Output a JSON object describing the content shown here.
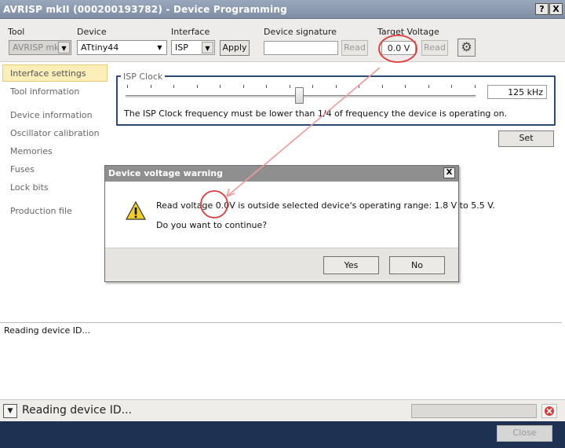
{
  "window": {
    "title": "AVRISP mkII (000200193782) - Device Programming",
    "help_label": "?",
    "close_label": "X"
  },
  "toolbar": {
    "tool_label": "Tool",
    "tool_value": "AVRISP mkII",
    "device_label": "Device",
    "device_value": "ATtiny44",
    "interface_label": "Interface",
    "interface_value": "ISP",
    "apply_label": "Apply",
    "signature_label": "Device signature",
    "signature_value": "",
    "signature_read_label": "Read",
    "voltage_label": "Target Voltage",
    "voltage_value": "0.0 V",
    "voltage_read_label": "Read",
    "settings_icon": "gear-icon"
  },
  "sidebar": {
    "items": [
      {
        "label": "Interface settings"
      },
      {
        "label": "Tool information"
      },
      {
        "label": "Device information"
      },
      {
        "label": "Oscillator calibration"
      },
      {
        "label": "Memories"
      },
      {
        "label": "Fuses"
      },
      {
        "label": "Lock bits"
      },
      {
        "label": "Production file"
      }
    ]
  },
  "isp": {
    "group_label": "ISP Clock",
    "clock_value": "125 kHz",
    "note": "The ISP Clock frequency must be lower than 1/4 of frequency the device is operating on.",
    "set_label": "Set"
  },
  "log": {
    "text": "Reading device ID..."
  },
  "status": {
    "text": "Reading device ID...",
    "expand_icon": "dropdown-arrow-icon",
    "cancel_icon": "stop-icon"
  },
  "footer": {
    "close_label": "Close"
  },
  "dialog": {
    "title": "Device voltage warning",
    "close_label": "X",
    "message_prefix": "Read voltage ",
    "message_voltage": "0.0V",
    "message_suffix": " is outside selected device's operating range: 1.8 V to 5.5 V.",
    "question": "Do you want to continue?",
    "yes_label": "Yes",
    "no_label": "No",
    "icon": "warning-icon"
  },
  "colors": {
    "annotation_red": "#e03a3a",
    "selected_nav": "#fbeeb8",
    "group_border": "#2c4a74",
    "bottom_bar": "#1f3152"
  }
}
